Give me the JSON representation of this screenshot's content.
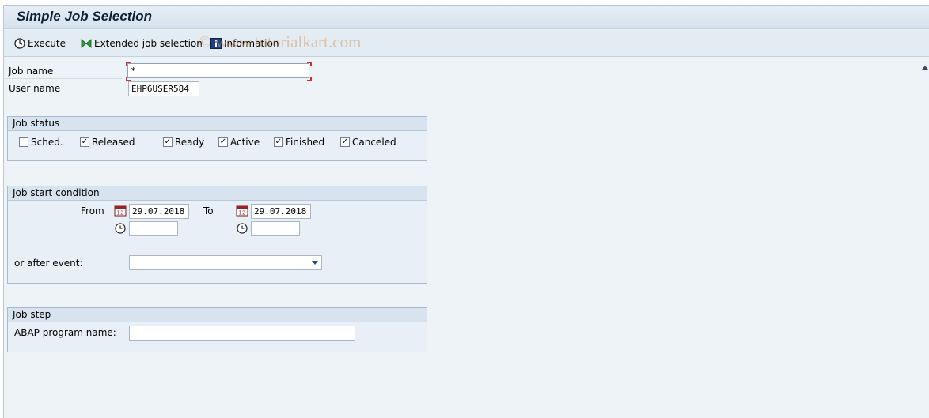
{
  "window": {
    "title": "Simple Job Selection"
  },
  "toolbar": {
    "execute_label": "Execute",
    "extended_label": "Extended job selection",
    "info_label": "Information",
    "watermark": "© www.tutorialkart.com"
  },
  "fields": {
    "job_name_label": "Job name",
    "job_name_value": "*",
    "user_name_label": "User name",
    "user_name_value": "EHP6USER584"
  },
  "job_status": {
    "title": "Job status",
    "items": [
      {
        "label": "Sched.",
        "checked": false
      },
      {
        "label": "Released",
        "checked": true
      },
      {
        "label": "Ready",
        "checked": true
      },
      {
        "label": "Active",
        "checked": true
      },
      {
        "label": "Finished",
        "checked": true
      },
      {
        "label": "Canceled",
        "checked": true
      }
    ]
  },
  "start_condition": {
    "title": "Job start condition",
    "from_label": "From",
    "from_date": "29.07.2018",
    "from_time": "",
    "to_label": "To",
    "to_date": "29.07.2018",
    "to_time": "",
    "event_label": "or after event:",
    "event_value": ""
  },
  "job_step": {
    "title": "Job step",
    "abap_label": "ABAP program name:",
    "abap_value": ""
  },
  "colors": {
    "accent": "#1d4f8a",
    "required": "#d0302a",
    "panel": "#e9eff6"
  }
}
